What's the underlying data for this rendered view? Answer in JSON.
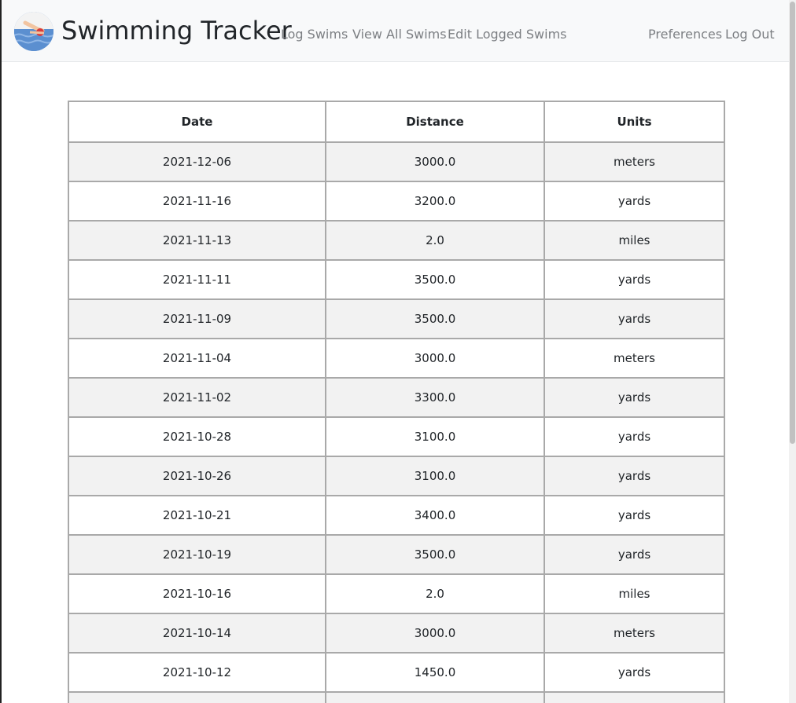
{
  "navbar": {
    "title": "Swimming Tracker",
    "links": [
      "Log Swims",
      "View All Swims",
      "Edit Logged Swims"
    ],
    "right_links": [
      "Preferences",
      "Log Out"
    ]
  },
  "table": {
    "headers": [
      "Date",
      "Distance",
      "Units"
    ],
    "rows": [
      [
        "2021-12-06",
        "3000.0",
        "meters"
      ],
      [
        "2021-11-16",
        "3200.0",
        "yards"
      ],
      [
        "2021-11-13",
        "2.0",
        "miles"
      ],
      [
        "2021-11-11",
        "3500.0",
        "yards"
      ],
      [
        "2021-11-09",
        "3500.0",
        "yards"
      ],
      [
        "2021-11-04",
        "3000.0",
        "meters"
      ],
      [
        "2021-11-02",
        "3300.0",
        "yards"
      ],
      [
        "2021-10-28",
        "3100.0",
        "yards"
      ],
      [
        "2021-10-26",
        "3100.0",
        "yards"
      ],
      [
        "2021-10-21",
        "3400.0",
        "yards"
      ],
      [
        "2021-10-19",
        "3500.0",
        "yards"
      ],
      [
        "2021-10-16",
        "2.0",
        "miles"
      ],
      [
        "2021-10-14",
        "3000.0",
        "meters"
      ],
      [
        "2021-10-12",
        "1450.0",
        "yards"
      ],
      [
        "",
        "",
        ""
      ]
    ]
  }
}
